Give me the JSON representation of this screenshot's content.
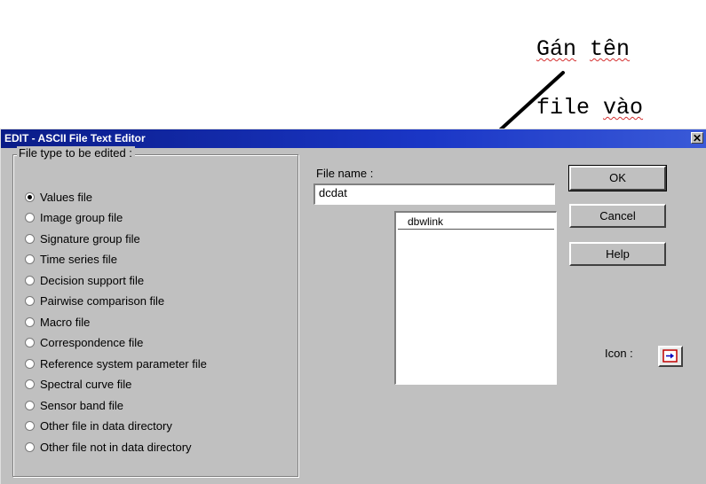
{
  "annotation": {
    "line1_word1": "Gán",
    "line1_word2": "tên",
    "line2_word1": "file",
    "line2_word2": "vào"
  },
  "dialog": {
    "title": "EDIT - ASCII File Text Editor",
    "close": "✕",
    "file_type_label": "File type to be edited :",
    "file_types": [
      {
        "label": "Values file",
        "selected": true
      },
      {
        "label": "Image group file",
        "selected": false
      },
      {
        "label": "Signature group file",
        "selected": false
      },
      {
        "label": "Time series file",
        "selected": false
      },
      {
        "label": "Decision support file",
        "selected": false
      },
      {
        "label": "Pairwise comparison file",
        "selected": false
      },
      {
        "label": "Macro file",
        "selected": false
      },
      {
        "label": "Correspondence file",
        "selected": false
      },
      {
        "label": "Reference system parameter file",
        "selected": false
      },
      {
        "label": "Spectral curve file",
        "selected": false
      },
      {
        "label": "Sensor band file",
        "selected": false
      },
      {
        "label": "Other file in data directory",
        "selected": false
      },
      {
        "label": "Other file not in data directory",
        "selected": false
      }
    ],
    "file_name_label": "File name :",
    "file_name_value": "dcdat",
    "file_list": [
      "dbwlink"
    ],
    "ok_label": "OK",
    "cancel_label": "Cancel",
    "help_label": "Help",
    "icon_label": "Icon :",
    "icon_name": "file-macro-icon"
  }
}
